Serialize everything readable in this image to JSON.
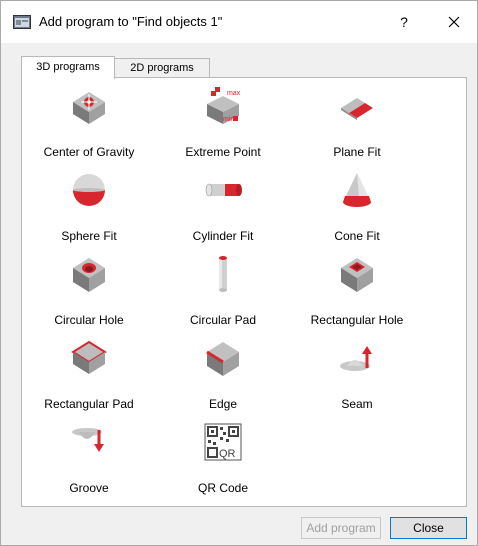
{
  "window": {
    "title": "Add program to \"Find objects 1\"",
    "help_label": "?"
  },
  "tabs": [
    {
      "label": "3D programs",
      "selected": true
    },
    {
      "label": "2D programs",
      "selected": false
    }
  ],
  "programs": [
    {
      "label": "Center of Gravity",
      "icon": "center-of-gravity-icon"
    },
    {
      "label": "Extreme Point",
      "icon": "extreme-point-icon",
      "icon_text": [
        "max",
        "min"
      ]
    },
    {
      "label": "Plane Fit",
      "icon": "plane-fit-icon"
    },
    {
      "label": "Sphere Fit",
      "icon": "sphere-fit-icon"
    },
    {
      "label": "Cylinder Fit",
      "icon": "cylinder-fit-icon"
    },
    {
      "label": "Cone Fit",
      "icon": "cone-fit-icon"
    },
    {
      "label": "Circular Hole",
      "icon": "circular-hole-icon"
    },
    {
      "label": "Circular Pad",
      "icon": "circular-pad-icon"
    },
    {
      "label": "Rectangular Hole",
      "icon": "rectangular-hole-icon"
    },
    {
      "label": "Rectangular Pad",
      "icon": "rectangular-pad-icon"
    },
    {
      "label": "Edge",
      "icon": "edge-icon"
    },
    {
      "label": "Seam",
      "icon": "seam-icon"
    },
    {
      "label": "Groove",
      "icon": "groove-icon"
    },
    {
      "label": "QR Code",
      "icon": "qr-code-icon",
      "icon_text": "QR"
    }
  ],
  "buttons": {
    "add_program": "Add program",
    "add_program_enabled": false,
    "close": "Close"
  },
  "colors": {
    "accent_red": "#d7262e",
    "cube_gray": "#8a8a8a",
    "focus_blue": "#0078d7"
  }
}
